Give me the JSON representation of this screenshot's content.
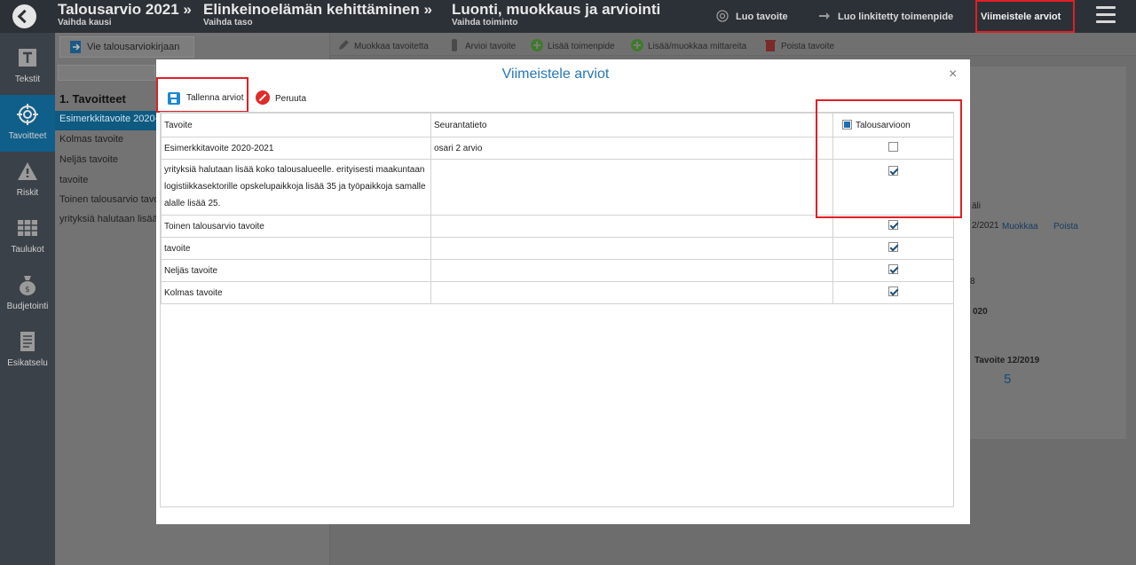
{
  "header": {
    "crumbs": [
      {
        "title": "Talousarvio 2021 »",
        "sub": "Vaihda kausi"
      },
      {
        "title": "Elinkeinoelämän kehittäminen »",
        "sub": "Vaihda taso"
      },
      {
        "title": "Luonti, muokkaus ja arviointi",
        "sub": "Vaihda toiminto"
      }
    ],
    "actions": {
      "create_goal": "Luo tavoite",
      "create_linked": "Luo linkitetty toimenpide",
      "finalize": "Viimeistele arviot"
    }
  },
  "sidebar": {
    "items": [
      {
        "label": "Tekstit",
        "icon": "text-icon"
      },
      {
        "label": "Tavoitteet",
        "icon": "target-icon"
      },
      {
        "label": "Riskit",
        "icon": "warning-icon"
      },
      {
        "label": "Taulukot",
        "icon": "table-icon"
      },
      {
        "label": "Budjetointi",
        "icon": "money-bag-icon"
      },
      {
        "label": "Esikatselu",
        "icon": "document-icon"
      }
    ]
  },
  "page": {
    "vie_button": "Vie talousarviokirjaan",
    "goals_heading": "1. Tavoitteet",
    "goals": [
      "Esimerkkitavoite 2020-2021",
      "Kolmas tavoite",
      "Neljäs tavoite",
      "tavoite",
      "Toinen talousarvio tavoite",
      "yrityksiä halutaan lisää koko talousalueelle"
    ],
    "toolbar": {
      "edit": "Muokkaa tavoitetta",
      "evaluate": "Arvioi tavoite",
      "add_action": "Lisää toimenpide",
      "add_metrics": "Lisää/muokkaa mittareita",
      "delete": "Poista tavoite"
    },
    "right_card": {
      "tab_fragment": "äli",
      "date_fragment": "2/2021",
      "edit_link": "Muokkaa",
      "delete_link": "Poista",
      "digit_fragment": "8",
      "year_fragment": "020",
      "goal_label": "Tavoite 12/2019",
      "goal_value": "5"
    }
  },
  "modal": {
    "title": "Viimeistele arviot",
    "close": "×",
    "save_label": "Tallenna arviot",
    "cancel_label": "Peruuta",
    "columns": [
      "Tavoite",
      "Seurantatieto",
      "Talousarvioon"
    ],
    "rows": [
      {
        "goal": "Esimerkkitavoite 2020-2021",
        "tracking": "osari 2 arvio",
        "checked": false
      },
      {
        "goal": "yrityksiä halutaan lisää koko talousalueelle. erityisesti maakuntaan logistiikkasektorille opskelupaikkoja lisää 35 ja työpaikkoja samalle alalle lisää 25.",
        "tracking": "",
        "checked": true
      },
      {
        "goal": "Toinen talousarvio tavoite",
        "tracking": "",
        "checked": true
      },
      {
        "goal": "tavoite",
        "tracking": "",
        "checked": true
      },
      {
        "goal": "Neljäs tavoite",
        "tracking": "",
        "checked": true
      },
      {
        "goal": "Kolmas tavoite",
        "tracking": "",
        "checked": true
      }
    ]
  }
}
